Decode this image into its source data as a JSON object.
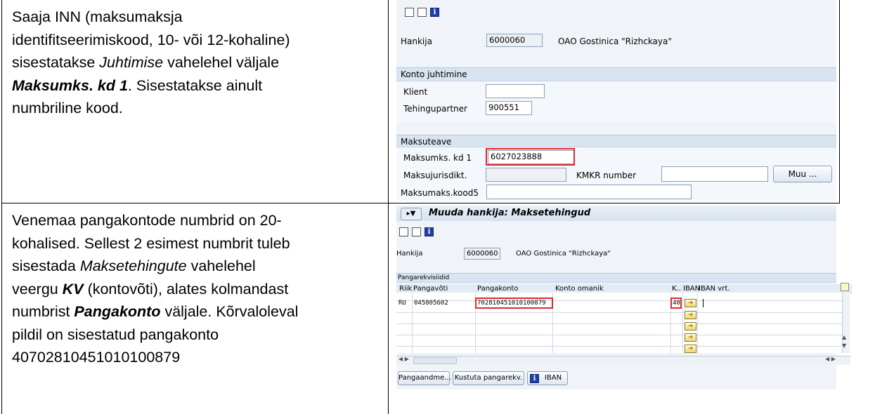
{
  "row1": {
    "text_lines": [
      [
        {
          "t": "Saaja INN (maksumaksja",
          "s": "n"
        }
      ],
      [
        {
          "t": "identifitseerimiskood, 10- või 12-kohaline)",
          "s": "n"
        }
      ],
      [
        {
          "t": "sisestatakse  ",
          "s": "n"
        },
        {
          "t": "Juhtimise",
          "s": "i"
        },
        {
          "t": " vahelehel väljale",
          "s": "n"
        }
      ],
      [
        {
          "t": "Maksumks. kd 1",
          "s": "bi"
        },
        {
          "t": ". Sisestatakse ainult",
          "s": "n"
        }
      ],
      [
        {
          "t": "numbriline kood.",
          "s": "n"
        }
      ]
    ],
    "sap": {
      "vendor_label": "Hankija",
      "vendor_value": "6000060",
      "vendor_name": "OAO Gostinica \"Rizhckaya\"",
      "section_account": "Konto juhtimine",
      "client_label": "Klient",
      "client_value": "",
      "partner_label": "Tehingupartner",
      "partner_value": "900551",
      "section_payment": "Maksuteave",
      "taxcode1_label": "Maksumks. kd 1",
      "taxcode1_value": "6027023888",
      "jurisdiction_label": "Maksujurisdikt.",
      "jurisdiction_value": "",
      "vat_label": "KMKR number",
      "vat_value": "",
      "more_button": "Muu ...",
      "taxcode5_label": "Maksumaks.kood5",
      "taxcode5_value": ""
    }
  },
  "row2": {
    "text_lines": [
      [
        {
          "t": "Venemaa pangakontode numbrid on 20-",
          "s": "n"
        }
      ],
      [
        {
          "t": "kohalised. Sellest 2 esimest numbrit tuleb",
          "s": "n"
        }
      ],
      [
        {
          "t": "sisestada ",
          "s": "n"
        },
        {
          "t": "Maksetehingute",
          "s": "i"
        },
        {
          "t": " vahelehel",
          "s": "n"
        }
      ],
      [
        {
          "t": "veergu ",
          "s": "n"
        },
        {
          "t": "KV",
          "s": "bi"
        },
        {
          "t": " (kontovõti), alates kolmandast",
          "s": "n"
        }
      ],
      [
        {
          "t": "numbrist ",
          "s": "n"
        },
        {
          "t": "Pangakonto",
          "s": "bi"
        },
        {
          "t": " väljale.  Kõrvaloleval",
          "s": "n"
        }
      ],
      [
        {
          "t": "pildil on sisestatud pangakonto",
          "s": "n"
        }
      ],
      [
        {
          "t": "40702810451010100879",
          "s": "n"
        }
      ]
    ],
    "sap": {
      "title": "Muuda hankija: Maksetehingud",
      "vendor_label": "Hankija",
      "vendor_value": "6000060",
      "vendor_name": "OAO Gostinica \"Rizhckaya\"",
      "section_bank": "Pangarekvisiidid",
      "columns": [
        "Riik",
        "Pangavõti",
        "Pangakonto",
        "Konto omanik",
        "K..",
        "IBAN",
        "IBAN vrt."
      ],
      "rows": [
        {
          "country": "RU",
          "bank_key": "045805602",
          "account": "702810451010100879",
          "holder": "",
          "key": "40"
        }
      ],
      "buttons": {
        "bank_data": "Pangaandme...",
        "delete": "Kustuta pangarekv.",
        "iban": "IBAN"
      }
    }
  },
  "colors": {
    "highlight_red": "#e0282e",
    "sap_section": "#d8e4f0",
    "sap_background": "#f0f4f9"
  }
}
